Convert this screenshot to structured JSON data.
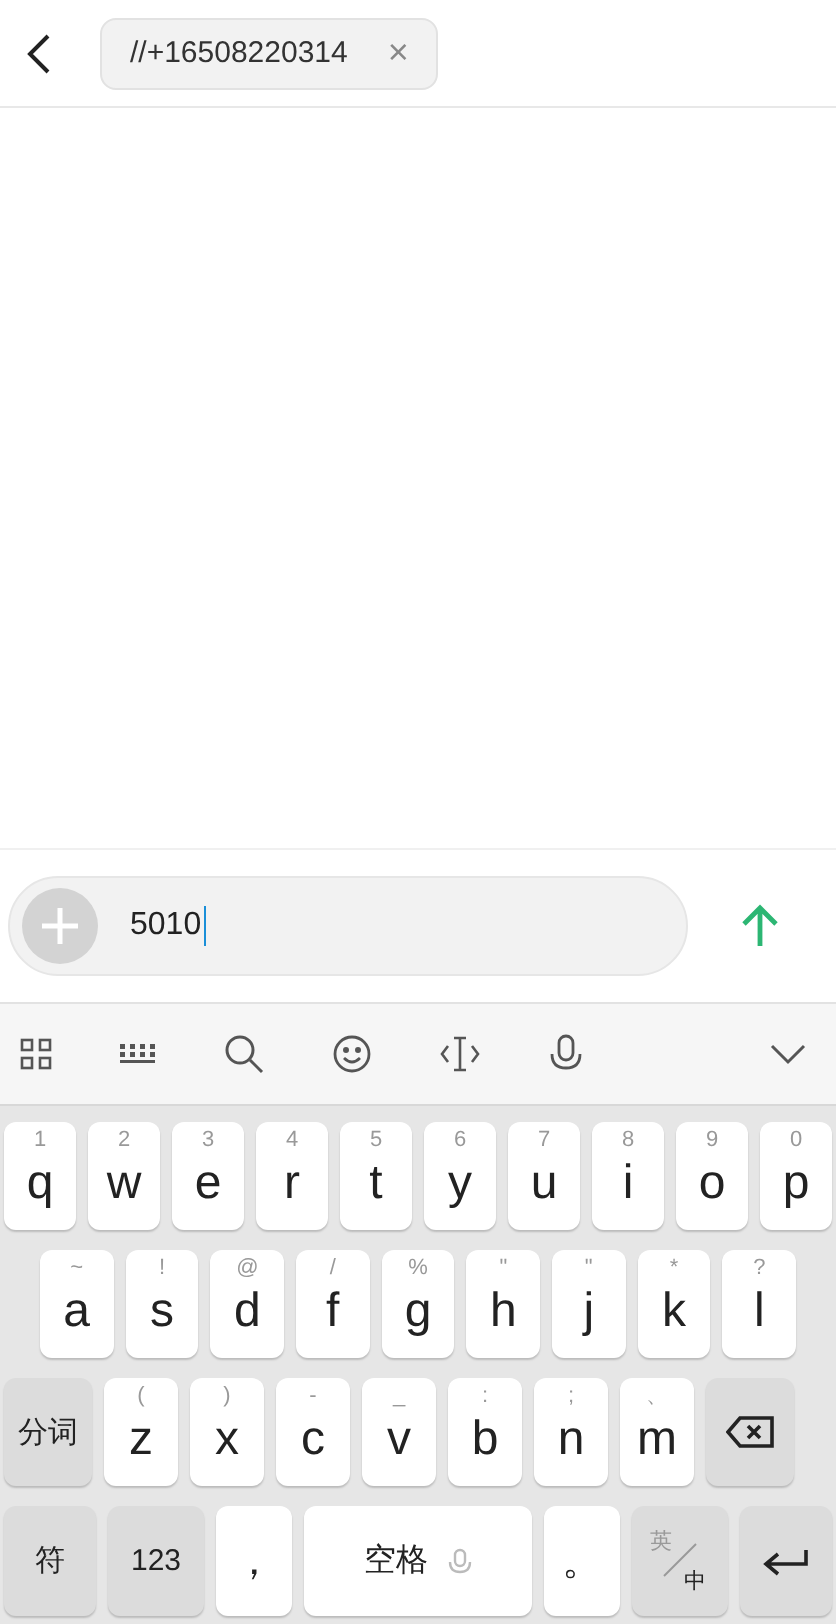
{
  "header": {
    "recipient": "//+16508220314",
    "clear": "×"
  },
  "composer": {
    "value": "5010"
  },
  "keyboard": {
    "rows": [
      {
        "keys": [
          {
            "kind": "letter",
            "hint": "1",
            "label": "q"
          },
          {
            "kind": "letter",
            "hint": "2",
            "label": "w"
          },
          {
            "kind": "letter",
            "hint": "3",
            "label": "e"
          },
          {
            "kind": "letter",
            "hint": "4",
            "label": "r"
          },
          {
            "kind": "letter",
            "hint": "5",
            "label": "t"
          },
          {
            "kind": "letter",
            "hint": "6",
            "label": "y"
          },
          {
            "kind": "letter",
            "hint": "7",
            "label": "u"
          },
          {
            "kind": "letter",
            "hint": "8",
            "label": "i"
          },
          {
            "kind": "letter",
            "hint": "9",
            "label": "o"
          },
          {
            "kind": "letter",
            "hint": "0",
            "label": "p"
          }
        ]
      },
      {
        "keys": [
          {
            "kind": "letter",
            "hint": "~",
            "label": "a"
          },
          {
            "kind": "letter",
            "hint": "!",
            "label": "s"
          },
          {
            "kind": "letter",
            "hint": "@",
            "label": "d"
          },
          {
            "kind": "letter",
            "hint": "/",
            "label": "f"
          },
          {
            "kind": "letter",
            "hint": "%",
            "label": "g"
          },
          {
            "kind": "letter",
            "hint": "\"",
            "label": "h"
          },
          {
            "kind": "letter",
            "hint": "\"",
            "label": "j"
          },
          {
            "kind": "letter",
            "hint": "*",
            "label": "k"
          },
          {
            "kind": "letter",
            "hint": "?",
            "label": "l"
          }
        ]
      },
      {
        "keys": [
          {
            "kind": "text",
            "label": "分词"
          },
          {
            "kind": "letter",
            "hint": "(",
            "label": "z"
          },
          {
            "kind": "letter",
            "hint": ")",
            "label": "x"
          },
          {
            "kind": "letter",
            "hint": "-",
            "label": "c"
          },
          {
            "kind": "letter",
            "hint": "_",
            "label": "v"
          },
          {
            "kind": "letter",
            "hint": ":",
            "label": "b"
          },
          {
            "kind": "letter",
            "hint": ";",
            "label": "n"
          },
          {
            "kind": "letter",
            "hint": "、",
            "label": "m"
          },
          {
            "kind": "backspace"
          }
        ]
      },
      {
        "keys": [
          {
            "kind": "text",
            "label": "符"
          },
          {
            "kind": "text",
            "label": "123"
          },
          {
            "kind": "punct",
            "label": "，"
          },
          {
            "kind": "space",
            "label": "空格"
          },
          {
            "kind": "punct",
            "label": "。"
          },
          {
            "kind": "lang",
            "top": "英",
            "bottom": "中"
          },
          {
            "kind": "enter"
          }
        ]
      }
    ]
  }
}
